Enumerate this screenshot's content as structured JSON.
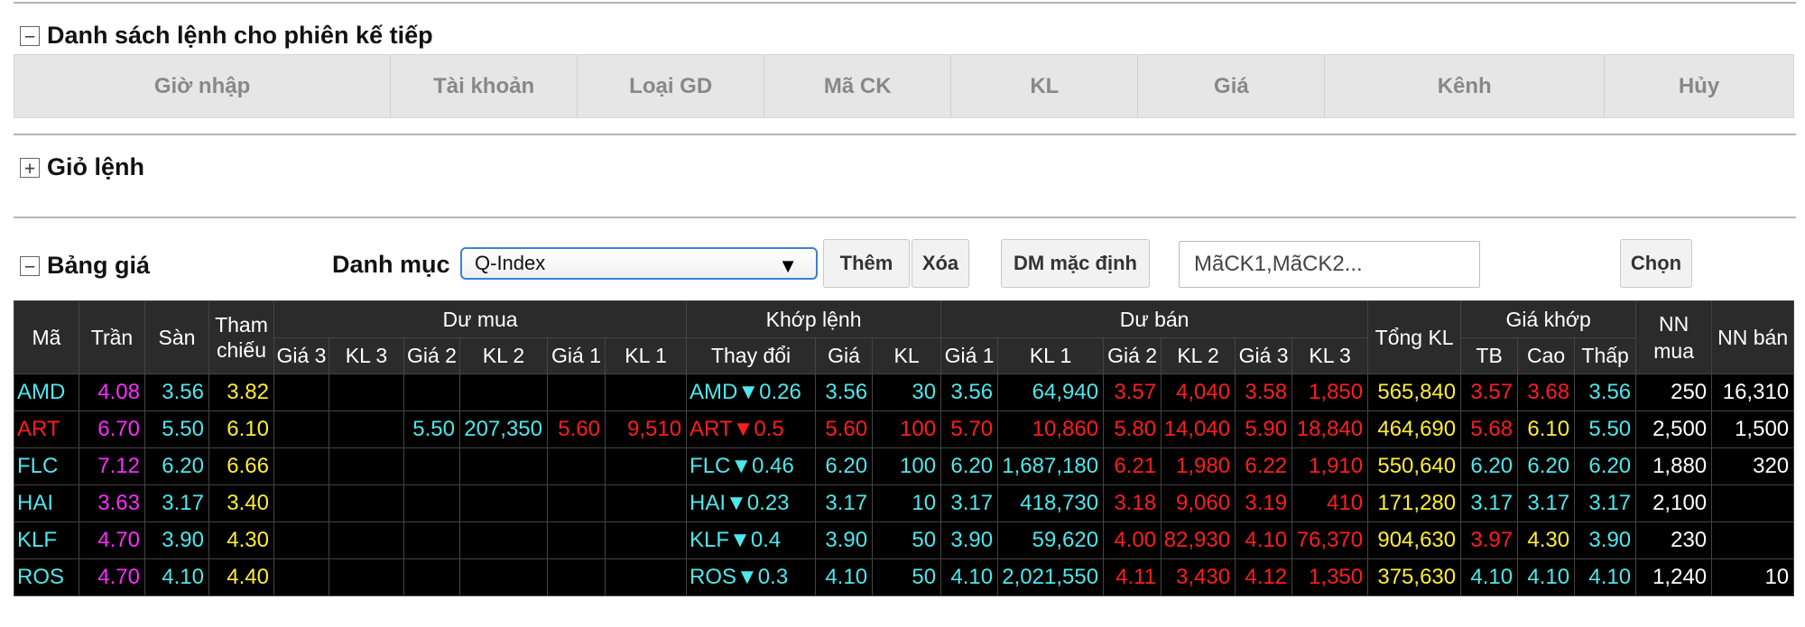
{
  "pending_orders": {
    "title": "Danh sách lệnh cho phiên kế tiếp",
    "toggle": "−",
    "columns": [
      "Giờ nhập",
      "Tài khoản",
      "Loại GD",
      "Mã CK",
      "KL",
      "Giá",
      "Kênh",
      "Hủy"
    ]
  },
  "cart": {
    "title": "Giỏ lệnh",
    "toggle": "+"
  },
  "price_board": {
    "title": "Bảng giá",
    "toggle": "−",
    "category_label": "Danh mục",
    "category_value": "Q-Index",
    "add_label": "Thêm",
    "delete_label": "Xóa",
    "default_label": "DM mặc định",
    "symbols_placeholder": "MãCK1,MãCK2...",
    "choose_label": "Chọn",
    "headers": {
      "ma": "Mã",
      "tran": "Trần",
      "san": "Sàn",
      "tham_chieu": "Tham chiếu",
      "du_mua": "Dư mua",
      "khop_lenh": "Khớp lệnh",
      "du_ban": "Dư bán",
      "tong_kl": "Tổng KL",
      "gia_khop": "Giá khớp",
      "nn_mua": "NN mua",
      "nn_ban": "NN bán",
      "gia3": "Giá 3",
      "kl3": "KL 3",
      "gia2": "Giá 2",
      "kl2": "KL 2",
      "gia1": "Giá 1",
      "kl1": "KL 1",
      "thay_doi": "Thay đổi",
      "gia": "Giá",
      "kl": "KL",
      "tb": "TB",
      "cao": "Cao",
      "thap": "Thấp"
    },
    "rows": [
      {
        "ma": "AMD",
        "tran": "4.08",
        "san": "3.56",
        "tc": "3.82",
        "bg3": "",
        "bk3": "",
        "bg2": "",
        "bk2": "",
        "bg1": "",
        "bk1": "",
        "chg": "AMD▼0.26",
        "gia": "3.56",
        "kl": "30",
        "sg1": "3.56",
        "sk1": "64,940",
        "sg2": "3.57",
        "sk2": "4,040",
        "sg3": "3.58",
        "sk3": "1,850",
        "tkl": "565,840",
        "tb": "3.57",
        "cao": "3.68",
        "thap": "3.56",
        "nnm": "250",
        "nnb": "16,310"
      },
      {
        "ma": "ART",
        "tran": "6.70",
        "san": "5.50",
        "tc": "6.10",
        "bg3": "",
        "bk3": "",
        "bg2": "5.50",
        "bk2": "207,350",
        "bg1": "5.60",
        "bk1": "9,510",
        "chg": "ART▼0.5",
        "gia": "5.60",
        "kl": "100",
        "sg1": "5.70",
        "sk1": "10,860",
        "sg2": "5.80",
        "sk2": "14,040",
        "sg3": "5.90",
        "sk3": "18,840",
        "tkl": "464,690",
        "tb": "5.68",
        "cao": "6.10",
        "thap": "5.50",
        "nnm": "2,500",
        "nnb": "1,500"
      },
      {
        "ma": "FLC",
        "tran": "7.12",
        "san": "6.20",
        "tc": "6.66",
        "bg3": "",
        "bk3": "",
        "bg2": "",
        "bk2": "",
        "bg1": "",
        "bk1": "",
        "chg": "FLC▼0.46",
        "gia": "6.20",
        "kl": "100",
        "sg1": "6.20",
        "sk1": "1,687,180",
        "sg2": "6.21",
        "sk2": "1,980",
        "sg3": "6.22",
        "sk3": "1,910",
        "tkl": "550,640",
        "tb": "6.20",
        "cao": "6.20",
        "thap": "6.20",
        "nnm": "1,880",
        "nnb": "320"
      },
      {
        "ma": "HAI",
        "tran": "3.63",
        "san": "3.17",
        "tc": "3.40",
        "bg3": "",
        "bk3": "",
        "bg2": "",
        "bk2": "",
        "bg1": "",
        "bk1": "",
        "chg": "HAI▼0.23",
        "gia": "3.17",
        "kl": "10",
        "sg1": "3.17",
        "sk1": "418,730",
        "sg2": "3.18",
        "sk2": "9,060",
        "sg3": "3.19",
        "sk3": "410",
        "tkl": "171,280",
        "tb": "3.17",
        "cao": "3.17",
        "thap": "3.17",
        "nnm": "2,100",
        "nnb": ""
      },
      {
        "ma": "KLF",
        "tran": "4.70",
        "san": "3.90",
        "tc": "4.30",
        "bg3": "",
        "bk3": "",
        "bg2": "",
        "bk2": "",
        "bg1": "",
        "bk1": "",
        "chg": "KLF▼0.4",
        "gia": "3.90",
        "kl": "50",
        "sg1": "3.90",
        "sk1": "59,620",
        "sg2": "4.00",
        "sk2": "82,930",
        "sg3": "4.10",
        "sk3": "76,370",
        "tkl": "904,630",
        "tb": "3.97",
        "cao": "4.30",
        "thap": "3.90",
        "nnm": "230",
        "nnb": ""
      },
      {
        "ma": "ROS",
        "tran": "4.70",
        "san": "4.10",
        "tc": "4.40",
        "bg3": "",
        "bk3": "",
        "bg2": "",
        "bk2": "",
        "bg1": "",
        "bk1": "",
        "chg": "ROS▼0.3",
        "gia": "4.10",
        "kl": "50",
        "sg1": "4.10",
        "sk1": "2,021,550",
        "sg2": "4.11",
        "sk2": "3,430",
        "sg3": "4.12",
        "sk3": "1,350",
        "tkl": "375,630",
        "tb": "4.10",
        "cao": "4.10",
        "thap": "4.10",
        "nnm": "1,240",
        "nnb": "10"
      }
    ],
    "row_colors": [
      {
        "ma": "cyan",
        "chg": "cyan",
        "gia": "cyan",
        "kl": "cyan",
        "bg2": "cyan",
        "bk2": "cyan",
        "bg1": "cyan",
        "bk1": "cyan",
        "sg1": "cyan",
        "sk1": "cyan",
        "sg2": "red",
        "sk2": "red",
        "sg3": "red",
        "sk3": "red",
        "tb": "red",
        "cao": "red",
        "thap": "cyan"
      },
      {
        "ma": "red",
        "chg": "red",
        "gia": "red",
        "kl": "red",
        "bg2": "cyan",
        "bk2": "cyan",
        "bg1": "red",
        "bk1": "red",
        "sg1": "red",
        "sk1": "red",
        "sg2": "red",
        "sk2": "red",
        "sg3": "red",
        "sk3": "red",
        "tb": "red",
        "cao": "yel",
        "thap": "cyan"
      },
      {
        "ma": "cyan",
        "chg": "cyan",
        "gia": "cyan",
        "kl": "cyan",
        "bg2": "cyan",
        "bk2": "cyan",
        "bg1": "cyan",
        "bk1": "cyan",
        "sg1": "cyan",
        "sk1": "cyan",
        "sg2": "red",
        "sk2": "red",
        "sg3": "red",
        "sk3": "red",
        "tb": "cyan",
        "cao": "cyan",
        "thap": "cyan"
      },
      {
        "ma": "cyan",
        "chg": "cyan",
        "gia": "cyan",
        "kl": "cyan",
        "bg2": "cyan",
        "bk2": "cyan",
        "bg1": "cyan",
        "bk1": "cyan",
        "sg1": "cyan",
        "sk1": "cyan",
        "sg2": "red",
        "sk2": "red",
        "sg3": "red",
        "sk3": "red",
        "tb": "cyan",
        "cao": "cyan",
        "thap": "cyan"
      },
      {
        "ma": "cyan",
        "chg": "cyan",
        "gia": "cyan",
        "kl": "cyan",
        "bg2": "cyan",
        "bk2": "cyan",
        "bg1": "cyan",
        "bk1": "cyan",
        "sg1": "cyan",
        "sk1": "cyan",
        "sg2": "red",
        "sk2": "red",
        "sg3": "red",
        "sk3": "red",
        "tb": "red",
        "cao": "yel",
        "thap": "cyan"
      },
      {
        "ma": "cyan",
        "chg": "cyan",
        "gia": "cyan",
        "kl": "cyan",
        "bg2": "cyan",
        "bk2": "cyan",
        "bg1": "cyan",
        "bk1": "cyan",
        "sg1": "cyan",
        "sk1": "cyan",
        "sg2": "red",
        "sk2": "red",
        "sg3": "red",
        "sk3": "red",
        "tb": "cyan",
        "cao": "cyan",
        "thap": "cyan"
      }
    ]
  },
  "colors": {
    "cyan": "#4de8ec",
    "magenta": "#ff2bff",
    "yellow": "#ffee33",
    "red": "#ff1e1e",
    "white": "#ffffff"
  }
}
